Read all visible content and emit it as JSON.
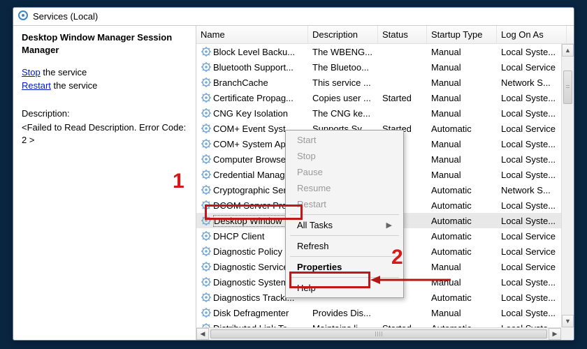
{
  "header": {
    "title": "Services (Local)"
  },
  "left": {
    "selected_service": "Desktop Window Manager Session Manager",
    "stop_label": "Stop",
    "stop_suffix": " the service",
    "restart_label": "Restart",
    "restart_suffix": " the service",
    "desc_label": "Description:",
    "desc_value": "<Failed to Read Description. Error Code: 2 >"
  },
  "columns": {
    "name": "Name",
    "description": "Description",
    "status": "Status",
    "startup": "Startup Type",
    "logon": "Log On As"
  },
  "rows": [
    {
      "name": "Block Level Backu...",
      "desc": "The WBENG...",
      "status": "",
      "startup": "Manual",
      "logon": "Local Syste..."
    },
    {
      "name": "Bluetooth Support...",
      "desc": "The Bluetoo...",
      "status": "",
      "startup": "Manual",
      "logon": "Local Service"
    },
    {
      "name": "BranchCache",
      "desc": "This service ...",
      "status": "",
      "startup": "Manual",
      "logon": "Network S..."
    },
    {
      "name": "Certificate Propag...",
      "desc": "Copies user ...",
      "status": "Started",
      "startup": "Manual",
      "logon": "Local Syste..."
    },
    {
      "name": "CNG Key Isolation",
      "desc": "The CNG ke...",
      "status": "",
      "startup": "Manual",
      "logon": "Local Syste..."
    },
    {
      "name": "COM+ Event Syst...",
      "desc": "Supports Sy...",
      "status": "Started",
      "startup": "Automatic",
      "logon": "Local Service"
    },
    {
      "name": "COM+ System Ap...",
      "desc": "",
      "status": "",
      "startup": "Manual",
      "logon": "Local Syste..."
    },
    {
      "name": "Computer Browser",
      "desc": "",
      "status": "",
      "startup": "Manual",
      "logon": "Local Syste..."
    },
    {
      "name": "Credential Manager",
      "desc": "",
      "status": "",
      "startup": "Manual",
      "logon": "Local Syste..."
    },
    {
      "name": "Cryptographic Ser...",
      "desc": "",
      "status": "",
      "startup": "Automatic",
      "logon": "Network S..."
    },
    {
      "name": "DCOM Server Pro...",
      "desc": "",
      "status": "",
      "startup": "Automatic",
      "logon": "Local Syste..."
    },
    {
      "name": "Desktop Window ...",
      "desc": "",
      "status": "",
      "startup": "Automatic",
      "logon": "Local Syste...",
      "selected": true
    },
    {
      "name": "DHCP Client",
      "desc": "",
      "status": "",
      "startup": "Automatic",
      "logon": "Local Service"
    },
    {
      "name": "Diagnostic Policy ...",
      "desc": "",
      "status": "",
      "startup": "Automatic",
      "logon": "Local Service"
    },
    {
      "name": "Diagnostic Service...",
      "desc": "",
      "status": "",
      "startup": "Manual",
      "logon": "Local Service"
    },
    {
      "name": "Diagnostic System...",
      "desc": "",
      "status": "",
      "startup": "Manual",
      "logon": "Local Syste..."
    },
    {
      "name": "Diagnostics Tracki...",
      "desc": "",
      "status": "",
      "startup": "Automatic",
      "logon": "Local Syste..."
    },
    {
      "name": "Disk Defragmenter",
      "desc": "Provides Dis...",
      "status": "",
      "startup": "Manual",
      "logon": "Local Syste..."
    },
    {
      "name": "Distributed Link Tr...",
      "desc": "Maintains li...",
      "status": "Started",
      "startup": "Automatic",
      "logon": "Local Syste..."
    }
  ],
  "menu": {
    "start": "Start",
    "stop": "Stop",
    "pause": "Pause",
    "resume": "Resume",
    "restart": "Restart",
    "all_tasks": "All Tasks",
    "refresh": "Refresh",
    "properties": "Properties",
    "help": "Help"
  },
  "annotations": {
    "one": "1",
    "two": "2"
  }
}
